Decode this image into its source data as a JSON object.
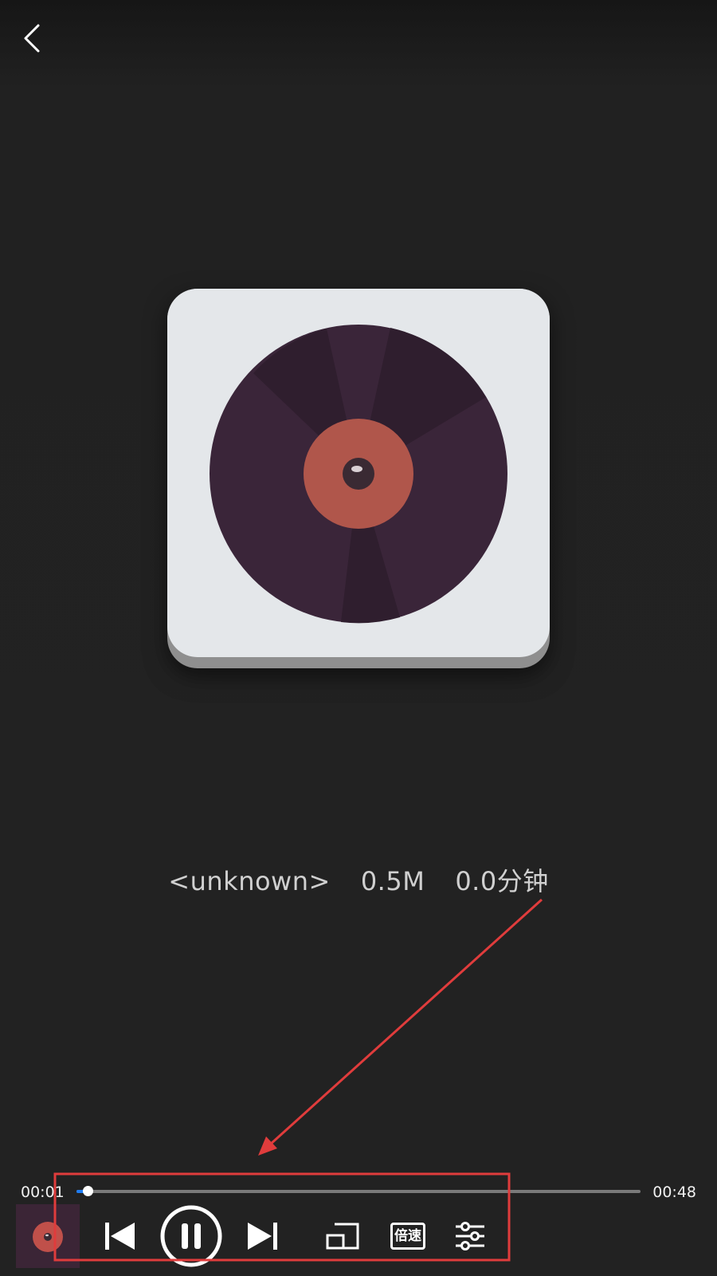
{
  "header": {
    "back_icon": "chevron-left-icon"
  },
  "album": {
    "icon": "vinyl-record-icon",
    "colors": {
      "card": "#e4e7ea",
      "disc": "#3a2539",
      "label": "#b0564b"
    }
  },
  "track_info": {
    "artist": "<unknown>",
    "size": "0.5M",
    "duration": "0.0分钟"
  },
  "player": {
    "current_time": "00:01",
    "total_time": "00:48",
    "progress": 0.02,
    "accent_color": "#1e7cf2",
    "controls": {
      "previous_icon": "skip-previous-icon",
      "pause_icon": "pause-icon",
      "next_icon": "skip-next-icon",
      "window_icon": "picture-in-picture-icon",
      "speed_label": "倍速",
      "equalizer_icon": "sliders-icon"
    }
  },
  "annotation": {
    "color": "#e03c3c"
  }
}
